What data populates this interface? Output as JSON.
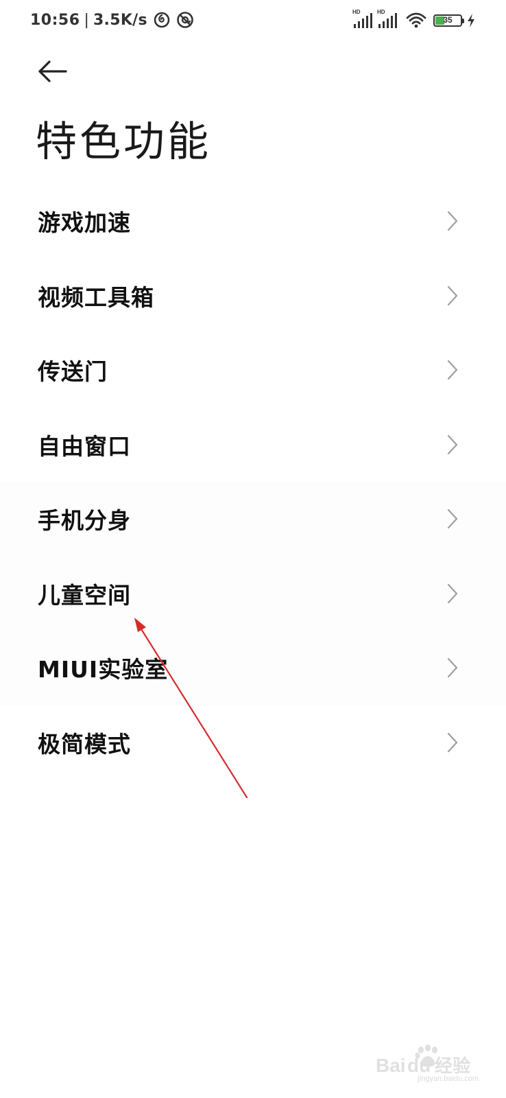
{
  "status_bar": {
    "time": "10:56",
    "separator": "|",
    "net_speed": "3.5K/s",
    "icons": [
      "netease-music-icon",
      "sync-at-icon"
    ],
    "signal_1_label": "HD",
    "signal_2_label": "HD",
    "battery_level": "35",
    "battery_fraction": 0.35,
    "battery_color": "#4caf50",
    "charging": true
  },
  "header": {
    "back_icon": "back-arrow-icon",
    "title": "特色功能"
  },
  "menu": {
    "items": [
      {
        "label": "游戏加速"
      },
      {
        "label": "视频工具箱"
      },
      {
        "label": "传送门"
      },
      {
        "label": "自由窗口"
      },
      {
        "label": "手机分身"
      },
      {
        "label": "儿童空间"
      },
      {
        "label": "MIUI实验室"
      },
      {
        "label": "极简模式"
      }
    ]
  },
  "annotation": {
    "color": "#d42b2b",
    "points_to": "儿童空间"
  },
  "watermark": {
    "brand": "Baidu经验",
    "url": "jingyan.baidu.com"
  }
}
